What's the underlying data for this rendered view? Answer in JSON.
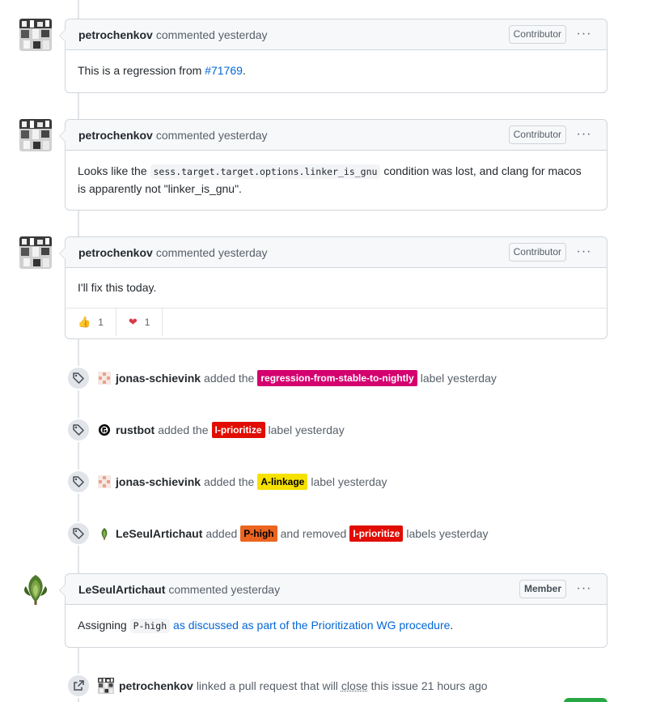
{
  "comments": [
    {
      "author": "petrochenkov",
      "action": "commented yesterday",
      "badge": "Contributor",
      "body": {
        "prefix": "This is a regression from ",
        "link": "#71769",
        "suffix": "."
      }
    },
    {
      "author": "petrochenkov",
      "action": "commented yesterday",
      "badge": "Contributor",
      "body": {
        "prefix": "Looks like the ",
        "code": "sess.target.target.options.linker_is_gnu",
        "middle": " condition was lost, and clang for macos",
        "line2": "is apparently not \"linker_is_gnu\"."
      }
    },
    {
      "author": "petrochenkov",
      "action": "commented yesterday",
      "badge": "Contributor",
      "body": {
        "text": "I'll fix this today."
      },
      "reactions": [
        {
          "icon": "thumbs-up",
          "emoji": "👍",
          "count": "1"
        },
        {
          "icon": "heart",
          "emoji": "❤",
          "count": "1"
        }
      ]
    },
    {
      "author": "LeSeulArtichaut",
      "action": "commented yesterday",
      "badge": "Member",
      "body": {
        "prefix": "Assigning ",
        "code": "P-high",
        "link": "as discussed as part of the Prioritization WG procedure",
        "suffix": "."
      }
    }
  ],
  "events": [
    {
      "actor": "jonas-schievink",
      "verb": "added the",
      "label": "regression-from-stable-to-nightly",
      "tail": "label yesterday"
    },
    {
      "actor": "rustbot",
      "verb": "added the",
      "label": "I-prioritize",
      "tail": "label yesterday"
    },
    {
      "actor": "jonas-schievink",
      "verb": "added the",
      "label": "A-linkage",
      "tail": "label yesterday"
    },
    {
      "actor": "LeSeulArtichaut",
      "verb": "added",
      "label": "P-high",
      "mid": "and removed",
      "label2": "I-prioritize",
      "tail": "labels yesterday"
    },
    {
      "actor": "petrochenkov",
      "verb": "linked a pull request that will",
      "underline": "close",
      "tail": "this issue 21 hours ago"
    }
  ],
  "kebab": "···",
  "colors": {
    "pink": "#d4006f",
    "red": "#e10c02",
    "yellow": "#f7e101",
    "orange": "#eb6420",
    "link": "#0366d6"
  }
}
